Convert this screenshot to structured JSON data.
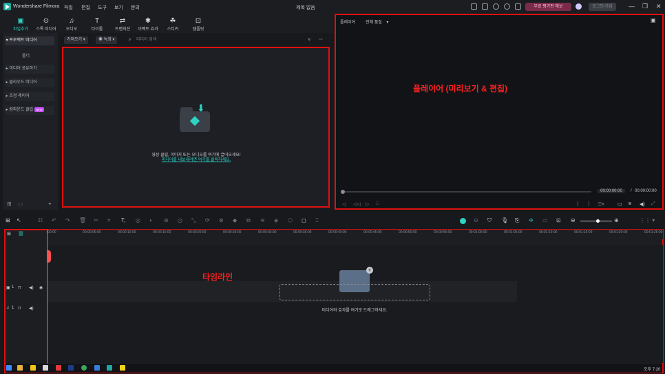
{
  "app": {
    "name": "Wondershare Filmora",
    "window_title": "제목 없음"
  },
  "menu": [
    "파일",
    "편집",
    "도구",
    "보기",
    "문의"
  ],
  "header": {
    "promo_label": "무료 평가판 해보",
    "login_label": "로그인/가입"
  },
  "window_controls": {
    "minimize": "—",
    "restore": "❐",
    "close": "✕"
  },
  "toolbar": [
    {
      "label": "파일추가",
      "icon": "▣"
    },
    {
      "label": "스톡 미디어",
      "icon": "⊙"
    },
    {
      "label": "오디오",
      "icon": "♫"
    },
    {
      "label": "타이틀",
      "icon": "T"
    },
    {
      "label": "트랜지션",
      "icon": "⇄"
    },
    {
      "label": "이펙트 효과",
      "icon": "✱"
    },
    {
      "label": "스티커",
      "icon": "☘"
    },
    {
      "label": "템플릿",
      "icon": "⊡"
    }
  ],
  "sidebar": {
    "project_media": "프로젝트 미디어",
    "folder": "폴더",
    "items": [
      "미디어 공유하기",
      "클라우드 미디어",
      "조정 레이어",
      "컴파운드 클립"
    ],
    "new_badge": "NEW"
  },
  "media_toolbar": {
    "import_label": "가져오기",
    "record_label": "녹화",
    "search_placeholder": "미디어 검색"
  },
  "media": {
    "drop_text": "영상 클립, 이미지 또는 오디오를 여기에 끌어오세요!",
    "drop_link": "미디어를 내보내려면 여기를 클릭하세요."
  },
  "player": {
    "tab_label": "플레이어",
    "quality_label": "전체 품질",
    "annotation": "플레이어 (미리보기 & 편집)",
    "current_time": "00:00:00:00",
    "separator": "/",
    "total_time": "00:00:00:00"
  },
  "timeline": {
    "annotation": "타임라인",
    "ticks": [
      "00:00",
      "00:00:05:00",
      "00:00:10:00",
      "00:00:15:00",
      "00:00:20:00",
      "00:00:25:00",
      "00:00:30:00",
      "00:00:35:00",
      "00:00:40:00",
      "00:00:45:00",
      "00:00:50:00",
      "00:00:55:00",
      "00:01:00:00",
      "00:01:05:00",
      "00:01:10:00",
      "00:01:15:00",
      "00:01:20:00",
      "00:01:25:00"
    ],
    "drop_text": "미디어와 효과를 여기로 드래그하세요.",
    "video_track_no": "1",
    "audio_track_no": "1"
  },
  "taskbar": {
    "clock": "오후 7:20"
  },
  "colors": {
    "accent": "#2fd3c4",
    "annotation_red": "#e01010",
    "promo": "#7b2b4a"
  }
}
